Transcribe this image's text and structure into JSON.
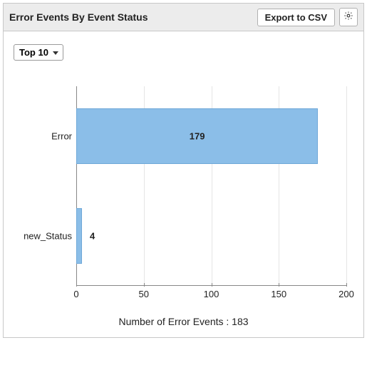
{
  "header": {
    "title": "Error Events By Event Status",
    "export_label": "Export to CSV"
  },
  "filter": {
    "selected": "Top 10"
  },
  "chart_data": {
    "type": "bar",
    "orientation": "horizontal",
    "categories": [
      "Error",
      "new_Status"
    ],
    "values": [
      179,
      4
    ],
    "xlabel": "Number of Error Events : 183",
    "ylabel": "",
    "xlim": [
      0,
      200
    ],
    "xticks": [
      0,
      50,
      100,
      150,
      200
    ],
    "bar_color": "#8bbee8"
  }
}
